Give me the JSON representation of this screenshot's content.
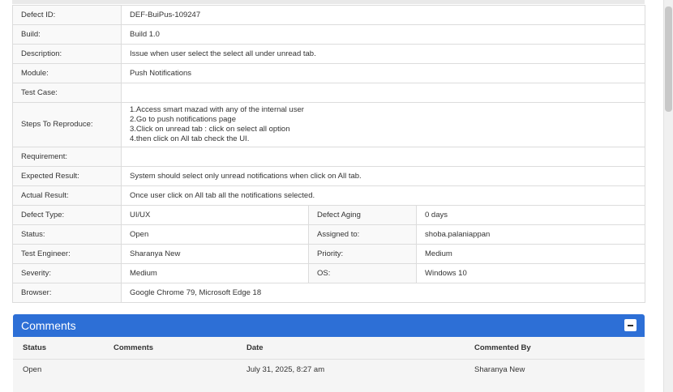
{
  "details": {
    "defect_id": {
      "label": "Defect ID:",
      "value": "DEF-BuiPus-109247"
    },
    "build": {
      "label": "Build:",
      "value": "Build 1.0"
    },
    "description": {
      "label": "Description:",
      "value": "Issue when user select the select all under unread tab."
    },
    "module": {
      "label": "Module:",
      "value": "Push Notifications"
    },
    "test_case": {
      "label": "Test Case:",
      "value": ""
    },
    "steps": {
      "label": "Steps To Reproduce:",
      "value": "1.Access smart mazad with any of the internal user\n2.Go to push notifications page\n3.Click on unread tab : click on select all option\n4.then click on All tab check the UI."
    },
    "requirement": {
      "label": "Requirement:",
      "value": ""
    },
    "expected": {
      "label": "Expected Result:",
      "value": "System should select only unread notifications when click on All tab."
    },
    "actual": {
      "label": "Actual Result:",
      "value": "Once user click on All tab all the notifications selected."
    },
    "defect_type": {
      "label": "Defect Type:",
      "value": "UI/UX"
    },
    "defect_aging": {
      "label": "Defect Aging",
      "value": "0 days"
    },
    "status": {
      "label": "Status:",
      "value": "Open"
    },
    "assigned_to": {
      "label": "Assigned to:",
      "value": "shoba.palaniappan"
    },
    "test_engineer": {
      "label": "Test Engineer:",
      "value": "Sharanya New"
    },
    "priority": {
      "label": "Priority:",
      "value": "Medium"
    },
    "severity": {
      "label": "Severity:",
      "value": "Medium"
    },
    "os": {
      "label": "OS:",
      "value": "Windows 10"
    },
    "browser": {
      "label": "Browser:",
      "value": "Google Chrome 79, Microsoft Edge 18"
    }
  },
  "comments": {
    "title": "Comments",
    "collapse_icon": "minus-icon",
    "columns": [
      "Status",
      "Comments",
      "Date",
      "Commented By"
    ],
    "rows": [
      {
        "status": "Open",
        "comment": "",
        "date": "July 31, 2025, 8:27 am",
        "by": "Sharanya New"
      }
    ]
  },
  "colors": {
    "header_blue": "#2d6fd6",
    "label_bg": "#f9f9f9",
    "border": "#dcdcdc"
  }
}
